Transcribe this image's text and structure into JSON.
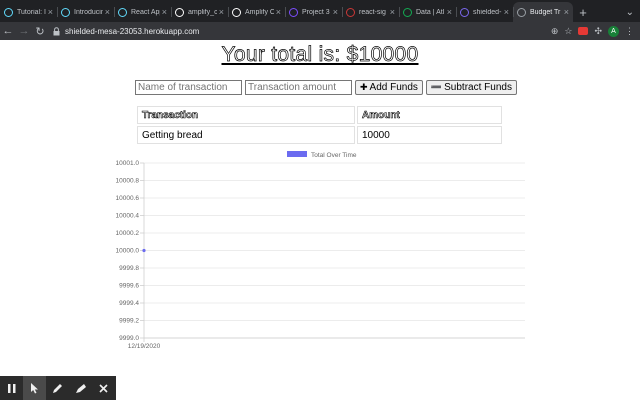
{
  "browser": {
    "tabs": [
      {
        "title": "Tutorial: I",
        "icon": "react-icon",
        "color": "#61dafb",
        "active": false
      },
      {
        "title": "Introducin",
        "icon": "react-icon",
        "color": "#61dafb",
        "active": false
      },
      {
        "title": "React App",
        "icon": "react-icon",
        "color": "#61dafb",
        "active": false
      },
      {
        "title": "amplify_c",
        "icon": "github-icon",
        "color": "#ffffff",
        "active": false
      },
      {
        "title": "Amplify C",
        "icon": "amplify-icon",
        "color": "#ffffff",
        "active": false
      },
      {
        "title": "Project 3",
        "icon": "project-icon",
        "color": "#7c4dff",
        "active": false
      },
      {
        "title": "react-sig",
        "icon": "npm-icon",
        "color": "#cb3837",
        "active": false
      },
      {
        "title": "Data | Atl",
        "icon": "mongodb-icon",
        "color": "#13aa52",
        "active": false
      },
      {
        "title": "shielded-",
        "icon": "heroku-icon",
        "color": "#7b68ee",
        "active": false
      },
      {
        "title": "Budget Tr",
        "icon": "page-icon",
        "color": "#9aa0a6",
        "active": true
      }
    ],
    "url": "shielded-mesa-23053.herokuapp.com",
    "avatar_letter": "A"
  },
  "app": {
    "total_text": "Your total is: $10000",
    "name_placeholder": "Name of transaction",
    "amount_placeholder": "Transaction amount",
    "add_label": "Add Funds",
    "subtract_label": "Subtract Funds",
    "table": {
      "headers": [
        "Transaction",
        "Amount"
      ],
      "rows": [
        {
          "name": "Getting bread",
          "amount": "10000"
        }
      ]
    }
  },
  "chart_data": {
    "type": "line",
    "legend": "Total Over Time",
    "legend_color": "#6b6bf0",
    "x": [
      "12/19/2020"
    ],
    "series": [
      {
        "name": "Total Over Time",
        "values": [
          10000
        ]
      }
    ],
    "ylim": [
      9999.0,
      10001.0
    ],
    "y_ticks": [
      "10001.0",
      "10000.8",
      "10000.6",
      "10000.4",
      "10000.2",
      "10000.0",
      "9999.8",
      "9999.6",
      "9999.4",
      "9999.2",
      "9999.0"
    ],
    "grid": true,
    "legend_position": "top"
  },
  "recorder": {
    "tools": [
      "pause-icon",
      "pointer-icon",
      "pen-icon",
      "highlighter-icon",
      "close-icon"
    ]
  }
}
